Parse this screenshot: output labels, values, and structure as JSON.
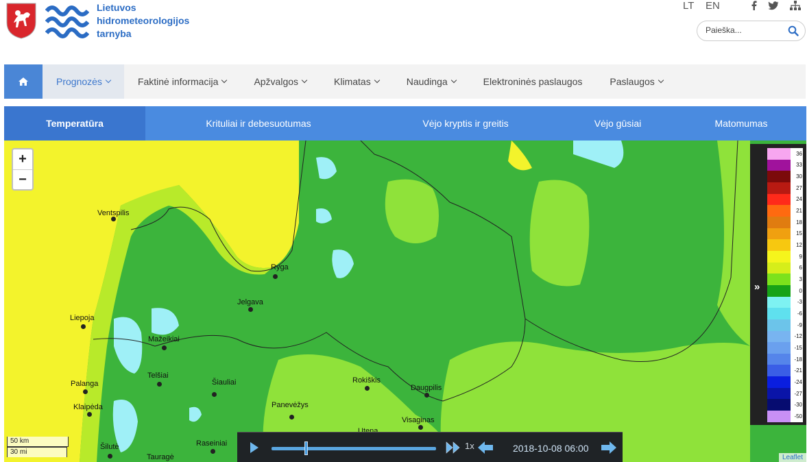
{
  "brand": {
    "line1": "Lietuvos",
    "line2": "hidrometeorologijos",
    "line3": "tarnyba"
  },
  "lang": {
    "lt": "LT",
    "en": "EN"
  },
  "search": {
    "placeholder": "Paieška..."
  },
  "mainnav": {
    "items": [
      {
        "label": "Prognozės",
        "dropdown": true,
        "active": true
      },
      {
        "label": "Faktinė informacija",
        "dropdown": true
      },
      {
        "label": "Apžvalgos",
        "dropdown": true
      },
      {
        "label": "Klimatas",
        "dropdown": true
      },
      {
        "label": "Naudinga",
        "dropdown": true
      },
      {
        "label": "Elektroninės paslaugos",
        "dropdown": false
      },
      {
        "label": "Paslaugos",
        "dropdown": true
      }
    ]
  },
  "subtabs": [
    {
      "label": "Temperatūra",
      "active": true
    },
    {
      "label": "Krituliai ir debesuotumas"
    },
    {
      "label": "Vėjo kryptis ir greitis"
    },
    {
      "label": "Vėjo gūsiai"
    },
    {
      "label": "Matomumas"
    }
  ],
  "map": {
    "cities": [
      "Ventspilis",
      "Ryga",
      "Jelgava",
      "Liepoja",
      "Mažeikiai",
      "Telšiai",
      "Šiauliai",
      "Palanga",
      "Klaipėda",
      "Panevėžys",
      "Rokiškis",
      "Daugpilis",
      "Visaginas",
      "Utena",
      "Šilutė",
      "Tauragė",
      "Raseiniai"
    ],
    "scale": {
      "km": "50 km",
      "mi": "30 mi"
    },
    "attribution": "Leaflet",
    "zoom_in": "+",
    "zoom_out": "−"
  },
  "legend": {
    "labels": [
      "36",
      "33",
      "30",
      "27",
      "24",
      "21",
      "18",
      "15",
      "12",
      "9",
      "6",
      "3",
      "0",
      "-3",
      "-6",
      "-9",
      "-12",
      "-15",
      "-18",
      "-21",
      "-24",
      "-27",
      "-30",
      "-50"
    ],
    "colors": [
      "#f7a6f0",
      "#a0129c",
      "#7b0a0a",
      "#b81a12",
      "#ff2a1a",
      "#ff6a10",
      "#e07c10",
      "#f0a010",
      "#f7c810",
      "#f5f51c",
      "#d6ee1a",
      "#7ce21c",
      "#17a317",
      "#7ef2f2",
      "#5fe0ee",
      "#6cc4ea",
      "#78b4f0",
      "#6aa0ee",
      "#5585ea",
      "#3a5ee6",
      "#0a1ee0",
      "#0a14a8",
      "#060c70",
      "#c890f5"
    ]
  },
  "player": {
    "speed": "1x",
    "time": "2018-10-08 06:00",
    "progress": 0.2
  }
}
